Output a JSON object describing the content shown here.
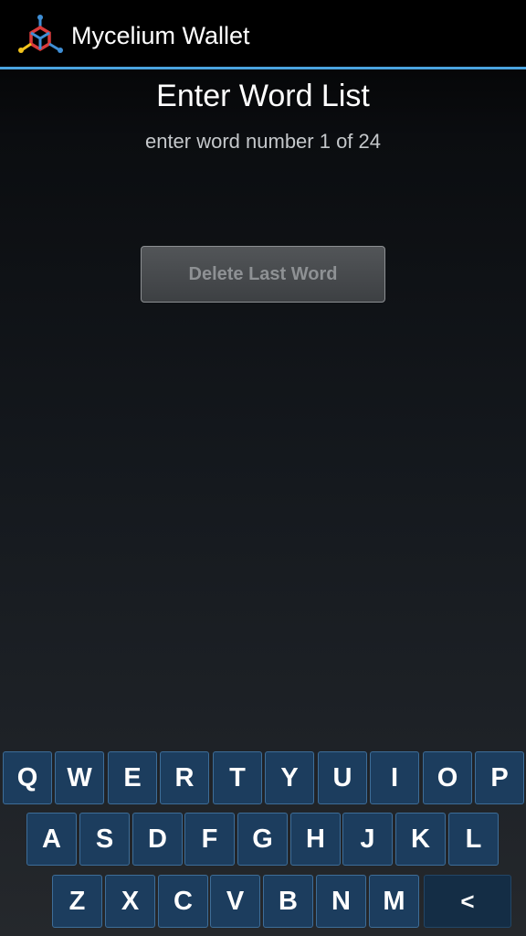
{
  "app": {
    "title": "Mycelium Wallet",
    "logo_icon": "mycelium-logo-icon",
    "accent_color": "#4aa3df"
  },
  "screen": {
    "heading": "Enter Word List",
    "subheading": "enter word number 1 of 24"
  },
  "delete_button": {
    "label": "Delete Last Word"
  },
  "keyboard": {
    "row1": [
      "Q",
      "W",
      "E",
      "R",
      "T",
      "Y",
      "U",
      "I",
      "O",
      "P"
    ],
    "row2": [
      "A",
      "S",
      "D",
      "F",
      "G",
      "H",
      "J",
      "K",
      "L"
    ],
    "row3": [
      "Z",
      "X",
      "C",
      "V",
      "B",
      "N",
      "M"
    ],
    "backspace_label": "<",
    "key_color": "#1c3d5e"
  }
}
